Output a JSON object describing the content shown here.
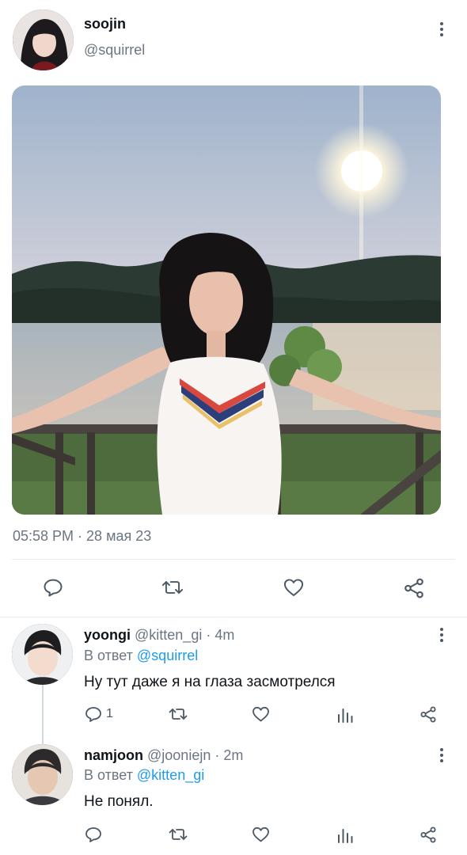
{
  "tweet": {
    "author_name": "soojin",
    "author_handle": "@squirrel",
    "timestamp": "05:58 PM · 28 мая 23",
    "actions": {
      "reply_icon": "reply-icon",
      "retweet_icon": "retweet-icon",
      "like_icon": "heart-icon",
      "share_icon": "share-icon"
    }
  },
  "replies": [
    {
      "name": "yoongi",
      "handle": "@kitten_gi",
      "time": "· 4m",
      "reply_to_prefix": "В ответ",
      "reply_to_handle": "@squirrel",
      "text": "Ну тут даже я на глаза засмотрелся",
      "reply_count": "1"
    },
    {
      "name": "namjoon",
      "handle": "@jooniejn",
      "time": "· 2m",
      "reply_to_prefix": "В ответ",
      "reply_to_handle": "@kitten_gi",
      "text": "Не понял.",
      "reply_count": ""
    }
  ],
  "colors": {
    "accent": "#1d9bf0",
    "muted_text": "#6b7682",
    "divider": "#e6ecf0"
  }
}
